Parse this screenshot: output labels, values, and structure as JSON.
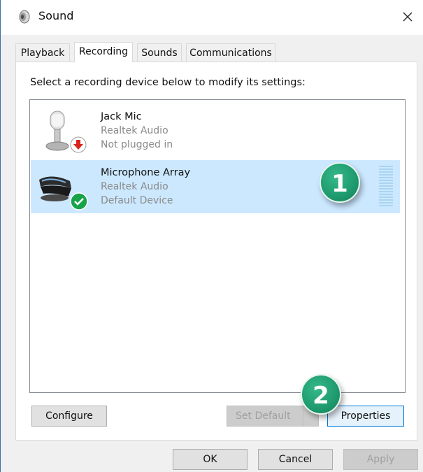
{
  "window": {
    "title": "Sound",
    "close_icon": "close-icon",
    "app_icon": "speaker-icon"
  },
  "tabs": [
    {
      "label": "Playback",
      "active": false
    },
    {
      "label": "Recording",
      "active": true
    },
    {
      "label": "Sounds",
      "active": false
    },
    {
      "label": "Communications",
      "active": false
    }
  ],
  "instruction": "Select a recording device below to modify its settings:",
  "devices": [
    {
      "name": "Jack Mic",
      "driver": "Realtek Audio",
      "status": "Not plugged in",
      "icon": "microphone-icon",
      "badge": "unplugged-arrow-icon",
      "badge_color": "#d9251d",
      "selected": false
    },
    {
      "name": "Microphone Array",
      "driver": "Realtek Audio",
      "status": "Default Device",
      "icon": "microphone-array-icon",
      "badge": "default-check-icon",
      "badge_color": "#17a34a",
      "selected": true
    }
  ],
  "callouts": [
    {
      "number": "1",
      "color": "#1e9a6e"
    },
    {
      "number": "2",
      "color": "#1e9a6e"
    }
  ],
  "buttons": {
    "configure": "Configure",
    "set_default": "Set Default",
    "properties": "Properties",
    "ok": "OK",
    "cancel": "Cancel",
    "apply": "Apply"
  },
  "colors": {
    "selection": "#cce8ff",
    "focus_border": "#0078d7",
    "meter": "#a9d4f2"
  }
}
